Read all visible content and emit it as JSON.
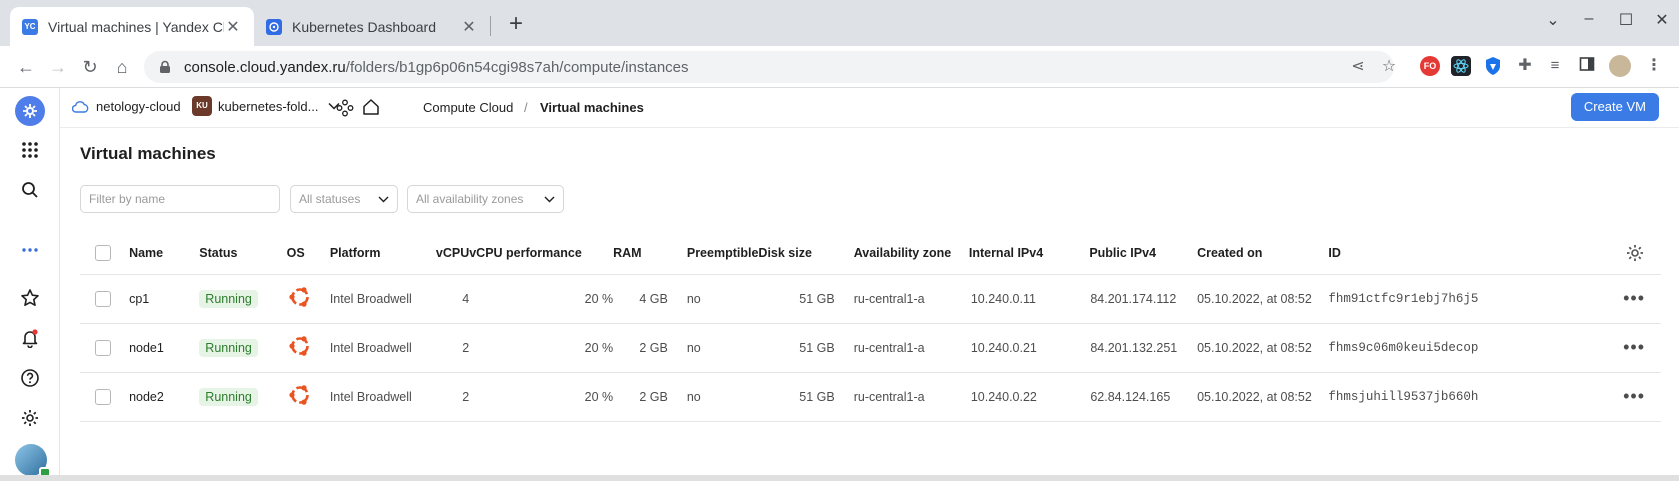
{
  "browser": {
    "tabs": [
      {
        "title": "Virtual machines | Yandex Clo",
        "favicon": "YC",
        "active": true
      },
      {
        "title": "Kubernetes Dashboard",
        "favicon": "kubernetes-icon",
        "active": false
      }
    ],
    "url_host": "console.cloud.yandex.ru",
    "url_path": "/folders/b1gp6p06n54cgi98s7ah/compute/instances",
    "extension_badge": "FO"
  },
  "header": {
    "cloud_name": "netology-cloud",
    "folder_avatar": "KU",
    "folder_name": "kubernetes-fold...",
    "breadcrumb_service": "Compute Cloud",
    "breadcrumb_separator": "/",
    "breadcrumb_page": "Virtual machines",
    "create_button": "Create VM"
  },
  "main": {
    "title": "Virtual machines",
    "filter_placeholder": "Filter by name",
    "status_filter": "All statuses",
    "zone_filter": "All availability zones"
  },
  "table": {
    "columns": {
      "name": "Name",
      "status": "Status",
      "os": "OS",
      "platform": "Platform",
      "vcpu": "vCPU",
      "vcpu_perf": "vCPU performance",
      "ram": "RAM",
      "preemptible": "Preemptible",
      "disk": "Disk size",
      "zone": "Availability zone",
      "internal_ip": "Internal IPv4",
      "public_ip": "Public IPv4",
      "created": "Created on",
      "id": "ID"
    },
    "rows": [
      {
        "name": "cp1",
        "status": "Running",
        "platform": "Intel Broadwell",
        "vcpu": "4",
        "vcpu_perf": "20 %",
        "ram": "4 GB",
        "preemptible": "no",
        "disk": "51 GB",
        "zone": "ru-central1-a",
        "internal_ip": "10.240.0.11",
        "public_ip": "84.201.174.112",
        "created": "05.10.2022, at 08:52",
        "id": "fhm91ctfc9r1ebj7h6j5"
      },
      {
        "name": "node1",
        "status": "Running",
        "platform": "Intel Broadwell",
        "vcpu": "2",
        "vcpu_perf": "20 %",
        "ram": "2 GB",
        "preemptible": "no",
        "disk": "51 GB",
        "zone": "ru-central1-a",
        "internal_ip": "10.240.0.21",
        "public_ip": "84.201.132.251",
        "created": "05.10.2022, at 08:52",
        "id": "fhms9c06m0keui5decop"
      },
      {
        "name": "node2",
        "status": "Running",
        "platform": "Intel Broadwell",
        "vcpu": "2",
        "vcpu_perf": "20 %",
        "ram": "2 GB",
        "preemptible": "no",
        "disk": "51 GB",
        "zone": "ru-central1-a",
        "internal_ip": "10.240.0.22",
        "public_ip": "62.84.124.165",
        "created": "05.10.2022, at 08:52",
        "id": "fhmsjuhill9537jb660h"
      }
    ]
  },
  "colors": {
    "accent": "#3a7be5",
    "status_running_bg": "#e6f4e6",
    "status_running_text": "#2d7d2d",
    "ubuntu": "#e95420"
  }
}
